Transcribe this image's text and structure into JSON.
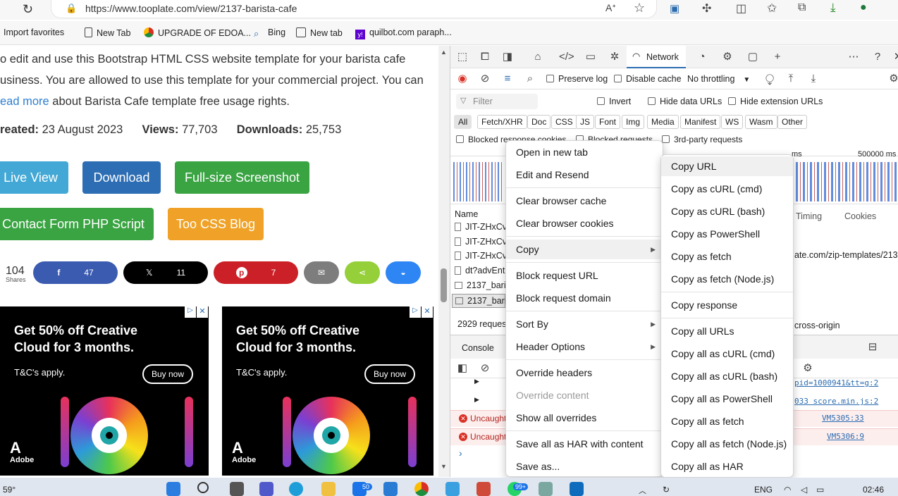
{
  "browser": {
    "url": "https://www.tooplate.com/view/2137-barista-cafe",
    "bookmarks": [
      "Import favorites",
      "New Tab",
      "UPGRADE OF EDOA...",
      "Bing",
      "New tab",
      "quilbot.com paraph..."
    ]
  },
  "page": {
    "intro_line1": "o edit and use this Bootstrap HTML CSS website template for your barista cafe",
    "intro_line2": "usiness. You are allowed to use this template for your commercial project. You can",
    "read_more": "ead more",
    "intro_line3_rest": " about Barista Cafe template free usage rights.",
    "created_label": "reated:",
    "created_value": " 23 August 2023",
    "views_label": "Views:",
    "views_value": " 77,703",
    "downloads_label": "Downloads:",
    "downloads_value": " 25,753",
    "buttons": {
      "live_view": "Live View",
      "download": "Download",
      "full_screenshot": "Full-size Screenshot",
      "contact_form": "Contact Form PHP Script",
      "css_blog": "Too CSS Blog"
    },
    "shares": {
      "count": "104",
      "label": "Shares",
      "facebook": "47",
      "x": "11",
      "pinterest": "7"
    },
    "ad": {
      "title_line1": "Get 50% off Creative",
      "title_line2": "Cloud for 3 months.",
      "tc": "T&C's apply.",
      "buy": "Buy now",
      "brand": "Adobe"
    }
  },
  "devtools": {
    "network_tab": "Network",
    "preserve_log": "Preserve log",
    "disable_cache": "Disable cache",
    "throttling": "No throttling",
    "filter_placeholder": "Filter",
    "invert": "Invert",
    "hide_data_urls": "Hide data URLs",
    "hide_ext_urls": "Hide extension URLs",
    "chips": [
      "All",
      "Fetch/XHR",
      "Doc",
      "CSS",
      "JS",
      "Font",
      "Img",
      "Media",
      "Manifest",
      "WS",
      "Wasm",
      "Other"
    ],
    "blocked_response_cookies": "Blocked response cookies",
    "blocked_requests": "Blocked requests",
    "third_party": "3rd-party requests",
    "timeline_label_1": "ms",
    "timeline_label_2": "500000 ms",
    "name_header": "Name",
    "requests": [
      "JIT-ZHxCv8",
      "JIT-ZHxCv8",
      "JIT-ZHxCv8",
      "dt?advEnti",
      "2137_baris",
      "2137_baris"
    ],
    "tab_timing": "Timing",
    "tab_cookies": "Cookies",
    "detail_url": "ate.com/zip-templates/2137_b",
    "detail_cross_origin": "cross-origin",
    "requests_count": "2929 request",
    "console_tab": "Console",
    "console_rows": [
      {
        "text": "Uncaught",
        "link": "VM5305:33"
      },
      {
        "text": "Uncaught",
        "link": "VM5306:9"
      }
    ],
    "console_links": [
      "pid=1000941&tt=g:2",
      "033 score.min.js:2"
    ]
  },
  "context_menu": {
    "items": [
      "Open in new tab",
      "Edit and Resend",
      "Clear browser cache",
      "Clear browser cookies",
      "Copy",
      "Block request URL",
      "Block request domain",
      "Sort By",
      "Header Options",
      "Override headers",
      "Override content",
      "Show all overrides",
      "Save all as HAR with content",
      "Save as..."
    ]
  },
  "copy_submenu": {
    "items": [
      "Copy URL",
      "Copy as cURL (cmd)",
      "Copy as cURL (bash)",
      "Copy as PowerShell",
      "Copy as fetch",
      "Copy as fetch (Node.js)",
      "Copy response",
      "Copy all URLs",
      "Copy all as cURL (cmd)",
      "Copy all as cURL (bash)",
      "Copy all as PowerShell",
      "Copy all as fetch",
      "Copy all as fetch (Node.js)",
      "Copy all as HAR"
    ]
  },
  "taskbar": {
    "weather": "59°",
    "badge_mail": "50",
    "badge_whatsapp": "99+",
    "lang": "ENG",
    "time": "02:46"
  },
  "colors": {
    "live_view": "#43a8d5",
    "download": "#2c6db3",
    "green": "#3aa443",
    "orange": "#efa227",
    "facebook": "#3b5bb0",
    "x": "#000000",
    "pinterest": "#cb2027",
    "email": "#7d7d7d",
    "sharethis": "#95d03a",
    "messenger": "#2e86f5"
  }
}
